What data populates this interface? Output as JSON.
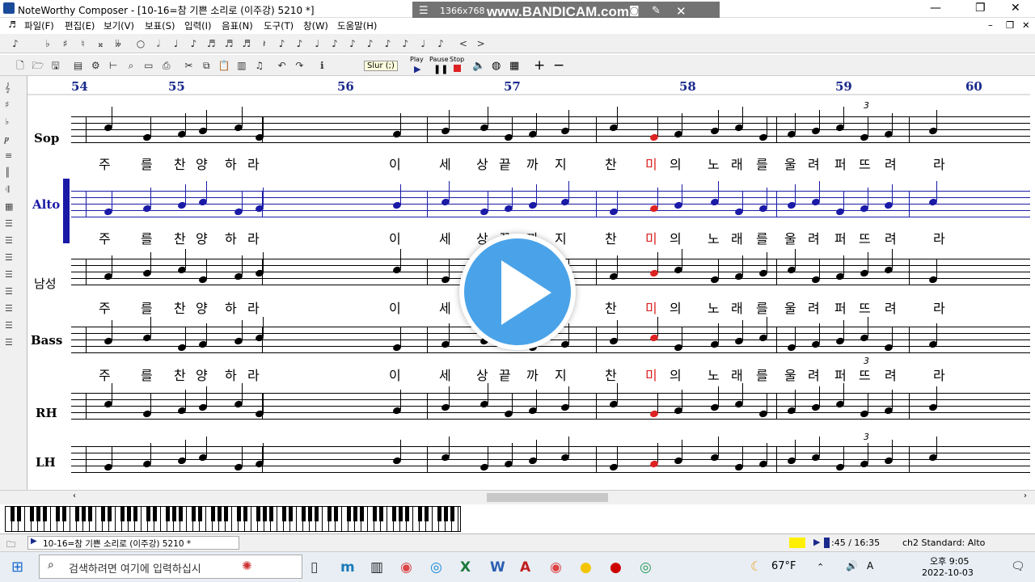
{
  "window": {
    "title": "NoteWorthy Composer - [10-16=참 기쁜 소리로 (이주강) 5210 *]",
    "controls": [
      "—",
      "❐",
      "✕"
    ]
  },
  "recorder": {
    "resolution": "1366x768",
    "brand": "www.BANDICAM.com"
  },
  "menu": [
    "파일(F)",
    "편집(E)",
    "보기(V)",
    "보표(S)",
    "입력(I)",
    "음표(N)",
    "도구(T)",
    "창(W)",
    "도움말(H)"
  ],
  "toolbar": {
    "slur_label": "Slur (;)",
    "play": "Play",
    "pause": "Pause",
    "stop": "Stop"
  },
  "measures": [
    "54",
    "55",
    "56",
    "57",
    "58",
    "59",
    "60"
  ],
  "staves": [
    {
      "name": "Sop",
      "color": "#000000",
      "lyrics": [
        "주",
        "를",
        "찬",
        "양",
        "하",
        "라",
        "이",
        "세",
        "상",
        "끝",
        "까",
        "지",
        "찬",
        "미",
        "의",
        "노",
        "래",
        "를",
        "울",
        "려",
        "퍼",
        "뜨",
        "려",
        "라"
      ]
    },
    {
      "name": "Alto",
      "color": "#1a1aa6",
      "lyrics": [
        "주",
        "를",
        "찬",
        "양",
        "하",
        "라",
        "이",
        "세",
        "상",
        "끝",
        "까",
        "지",
        "찬",
        "미",
        "의",
        "노",
        "래",
        "를",
        "울",
        "려",
        "퍼",
        "뜨",
        "려",
        "라"
      ]
    },
    {
      "name": "남성",
      "color": "#000000",
      "lyrics": [
        "주",
        "를",
        "찬",
        "양",
        "하",
        "라",
        "이",
        "세",
        "상",
        "끝",
        "까",
        "지",
        "찬",
        "미",
        "의",
        "노",
        "래",
        "를",
        "울",
        "려",
        "퍼",
        "뜨",
        "려",
        "라"
      ]
    },
    {
      "name": "Bass",
      "color": "#000000",
      "lyrics": [
        "주",
        "를",
        "찬",
        "양",
        "하",
        "라",
        "이",
        "세",
        "상",
        "끝",
        "까",
        "지",
        "찬",
        "미",
        "의",
        "노",
        "래",
        "를",
        "울",
        "려",
        "퍼",
        "뜨",
        "려",
        "라"
      ]
    },
    {
      "name": "RH",
      "color": "#000000"
    },
    {
      "name": "LH",
      "color": "#000000"
    }
  ],
  "triplet": "3",
  "status": {
    "file": "10-16=참 기쁜 소리로 (이주강) 5210 *",
    "time": ":45 / 16:35",
    "staff": "ch2 Standard: Alto"
  },
  "taskbar": {
    "search_placeholder": "검색하려면 여기에 입력하십시",
    "weather": "67°F",
    "time": "오후 9:05",
    "date": "2022-10-03",
    "ime": "A"
  }
}
